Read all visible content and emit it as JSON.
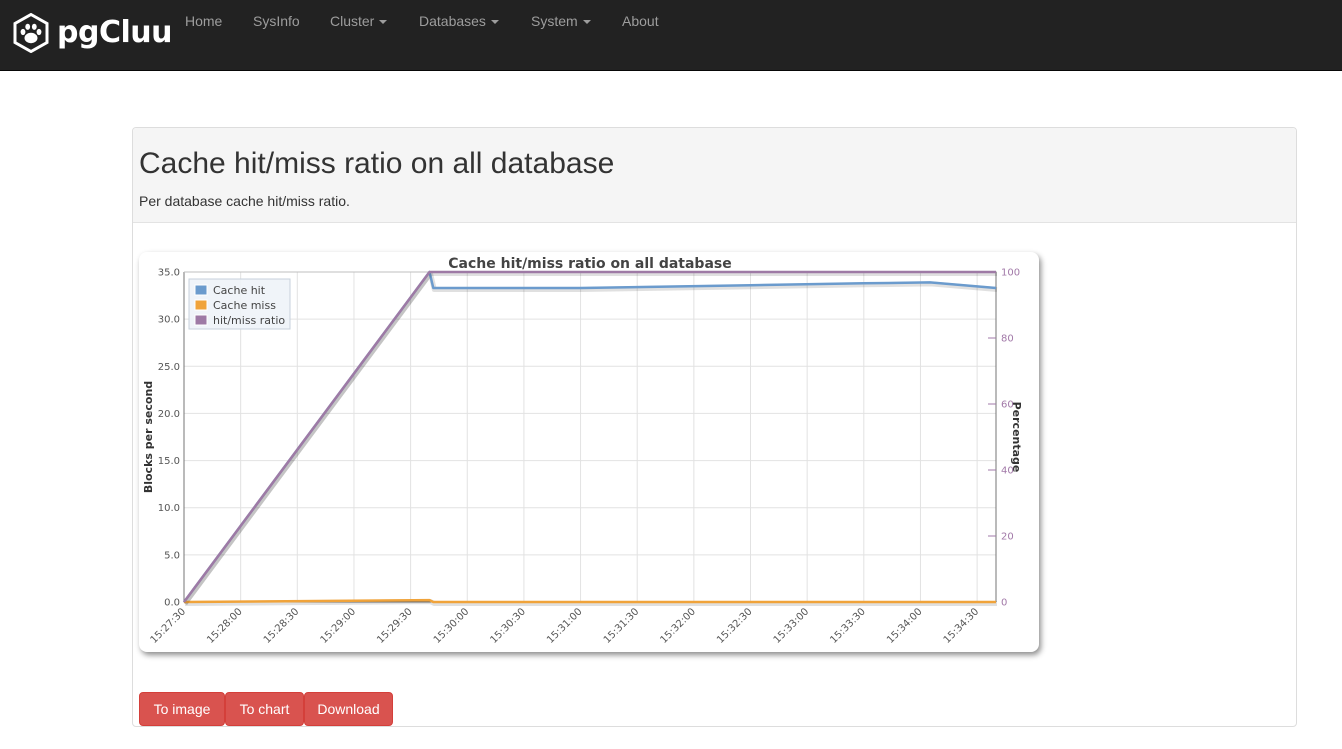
{
  "navbar": {
    "brand": "pgCluu",
    "items": [
      {
        "label": "Home",
        "dropdown": false
      },
      {
        "label": "SysInfo",
        "dropdown": false
      },
      {
        "label": "Cluster",
        "dropdown": true
      },
      {
        "label": "Databases",
        "dropdown": true
      },
      {
        "label": "System",
        "dropdown": true
      },
      {
        "label": "About",
        "dropdown": false
      }
    ]
  },
  "page": {
    "title": "Cache hit/miss ratio on all database",
    "description": "Per database cache hit/miss ratio."
  },
  "buttons": {
    "to_image": "To image",
    "to_chart": "To chart",
    "download": "Download"
  },
  "colors": {
    "navbar_bg": "#222222",
    "button_bg": "#d9534f",
    "cache_hit": "#6b9bcd",
    "cache_miss": "#f0a33a",
    "hit_miss_ratio": "#9e7aa5"
  },
  "chart_data": {
    "type": "line",
    "title": "Cache hit/miss ratio on all database",
    "ylabel": "Blocks per second",
    "y2label": "Percentage",
    "ylim": [
      0,
      35
    ],
    "y2lim": [
      0,
      100
    ],
    "y_ticks": [
      "0.0",
      "5.0",
      "10.0",
      "15.0",
      "20.0",
      "25.0",
      "30.0",
      "35.0"
    ],
    "y2_ticks": [
      "0",
      "20",
      "40",
      "60",
      "80",
      "100"
    ],
    "x_ticks": [
      "15:27:30",
      "15:28:00",
      "15:28:30",
      "15:29:00",
      "15:29:30",
      "15:30:00",
      "15:30:30",
      "15:31:00",
      "15:31:30",
      "15:32:00",
      "15:32:30",
      "15:33:00",
      "15:33:30",
      "15:34:00",
      "15:34:30"
    ],
    "legend_position": "top-left",
    "grid": true,
    "series": [
      {
        "name": "Cache hit",
        "axis": "left",
        "x": [
          "15:27:30",
          "15:29:40",
          "15:29:42",
          "15:31:00",
          "15:32:30",
          "15:33:30",
          "15:34:05",
          "15:34:40"
        ],
        "values": [
          0,
          35,
          33.3,
          33.3,
          33.6,
          33.8,
          33.9,
          33.3
        ]
      },
      {
        "name": "Cache miss",
        "axis": "left",
        "x": [
          "15:27:30",
          "15:29:40",
          "15:29:42",
          "15:34:40"
        ],
        "values": [
          0,
          0.2,
          0,
          0
        ]
      },
      {
        "name": "hit/miss ratio",
        "axis": "right",
        "x": [
          "15:27:30",
          "15:29:40",
          "15:34:40"
        ],
        "values": [
          0,
          100,
          100
        ]
      }
    ]
  }
}
